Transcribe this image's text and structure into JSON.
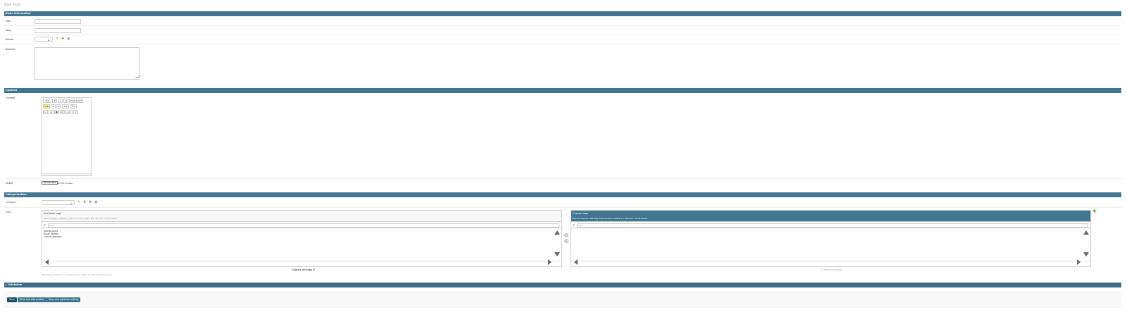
{
  "page": {
    "title": "Add Post"
  },
  "sections": {
    "basic": "Basic information",
    "content": "Content",
    "categorization": "Categorization",
    "validation": "Validation"
  },
  "fields": {
    "title_label": "Title",
    "slug_label": "Slug",
    "author_label": "Author",
    "resume_label": "Resume",
    "content_label": "Content",
    "image_label": "Image",
    "category_label": "Category",
    "tags_label": "Tags",
    "author_value": "---------",
    "category_value": "---------"
  },
  "editor": {
    "row1": [
      "¶ ▾",
      "B",
      "I",
      "U",
      "Font size ▾"
    ],
    "row2": [
      "A ▾",
      "≡",
      "≡",
      "≡ ▾",
      "☰ ▾"
    ],
    "row3": [
      "⇤",
      "⇥",
      "◼",
      "⊡",
      "</>",
      "?"
    ]
  },
  "image": {
    "button": "Choose File",
    "status": "No file chosen"
  },
  "tags": {
    "available_title": "Available tags",
    "available_help": "Choose tags by selecting them and then select the \"Choose\" arrow button.",
    "chosen_title": "Chosen tags",
    "chosen_help": "Remove tags by selecting them and then select the \"Remove\" arrow button.",
    "filter_placeholder": "Filter",
    "available_items": [
      "Django Jazzy",
      "Rusty Yorkers",
      "Cascus Ablivera"
    ],
    "choose_all": "Choose all tags ⊕",
    "remove_all": "⊖ Remove all tags",
    "help": "Hold down \"Control\", or \"Command\" on a Mac, to select more than one."
  },
  "icons": {
    "edit": "pencil-icon",
    "add": "plus-icon",
    "delete": "close-icon",
    "view": "eye-icon",
    "search": "search-icon"
  },
  "actions": {
    "save": "Save",
    "save_add_another": "Save and add another",
    "save_continue": "Save and continue editing"
  },
  "colors": {
    "header": "#417690",
    "primary_button": "#205067",
    "add_green": "#58a52a"
  }
}
